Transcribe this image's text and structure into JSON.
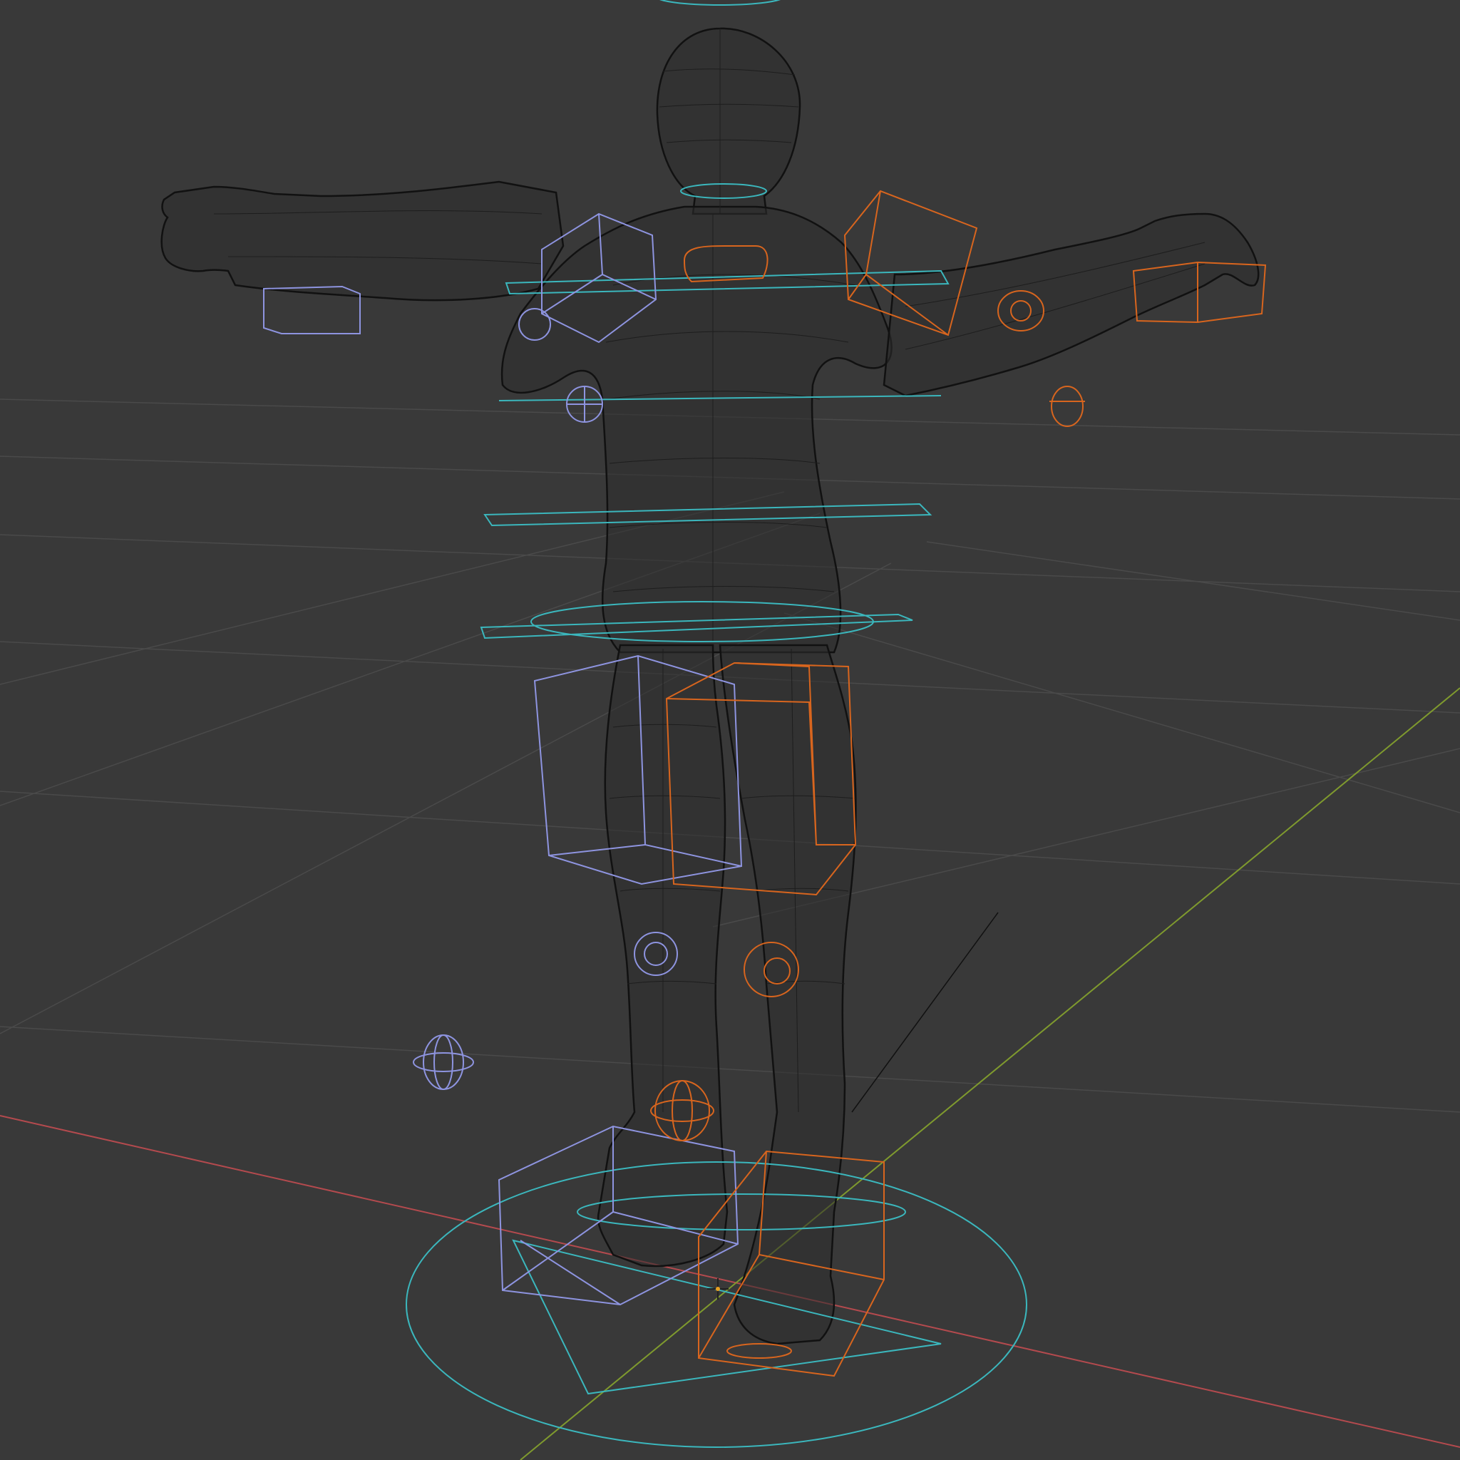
{
  "app": {
    "name": "",
    "view_mode": "wireframe",
    "overlay": "rig-controls"
  },
  "colors": {
    "background": "#393939",
    "grid": "#4a4a4a",
    "axis_x": "#b44a4e",
    "axis_y": "#7f9a2e",
    "mesh": "#141414",
    "control_center": "#3bb7bd",
    "control_left": "#8e94e0",
    "control_right": "#d8651e"
  },
  "icons": {
    "origin": "origin-cross-icon",
    "empty": "empty-axis-icon"
  }
}
